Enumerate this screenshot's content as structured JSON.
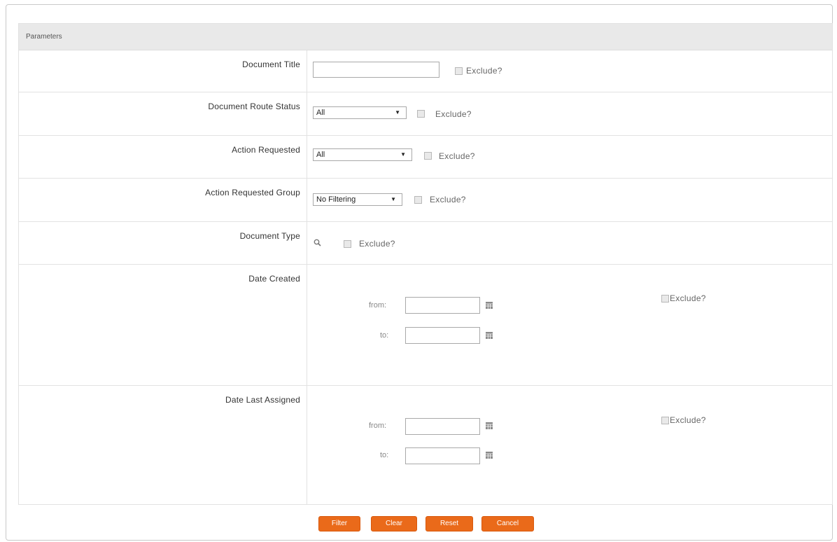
{
  "panel": {
    "title": "Parameters"
  },
  "fields": {
    "document_title": {
      "label": "Document Title",
      "value": "",
      "exclude": "Exclude?"
    },
    "document_route_status": {
      "label": "Document Route Status",
      "selected": "All",
      "exclude": "Exclude?"
    },
    "action_requested": {
      "label": "Action Requested",
      "selected": "All",
      "exclude": "Exclude?"
    },
    "action_requested_group": {
      "label": "Action Requested Group",
      "selected": "No Filtering",
      "exclude": "Exclude?"
    },
    "document_type": {
      "label": "Document Type",
      "exclude": "Exclude?"
    },
    "date_created": {
      "label": "Date Created",
      "from_label": "from:",
      "to_label": "to:",
      "from_value": "",
      "to_value": "",
      "exclude": "Exclude?"
    },
    "date_last_assigned": {
      "label": "Date Last Assigned",
      "from_label": "from:",
      "to_label": "to:",
      "from_value": "",
      "to_value": "",
      "exclude": "Exclude?"
    }
  },
  "icons": {
    "lookup": "search-icon",
    "calendar": "calendar-icon"
  },
  "buttons": {
    "filter": "Filter",
    "clear": "Clear",
    "reset": "Reset",
    "cancel": "Cancel"
  },
  "colors": {
    "button": "#ea6a1a",
    "header_bg": "#e9e9e9"
  }
}
